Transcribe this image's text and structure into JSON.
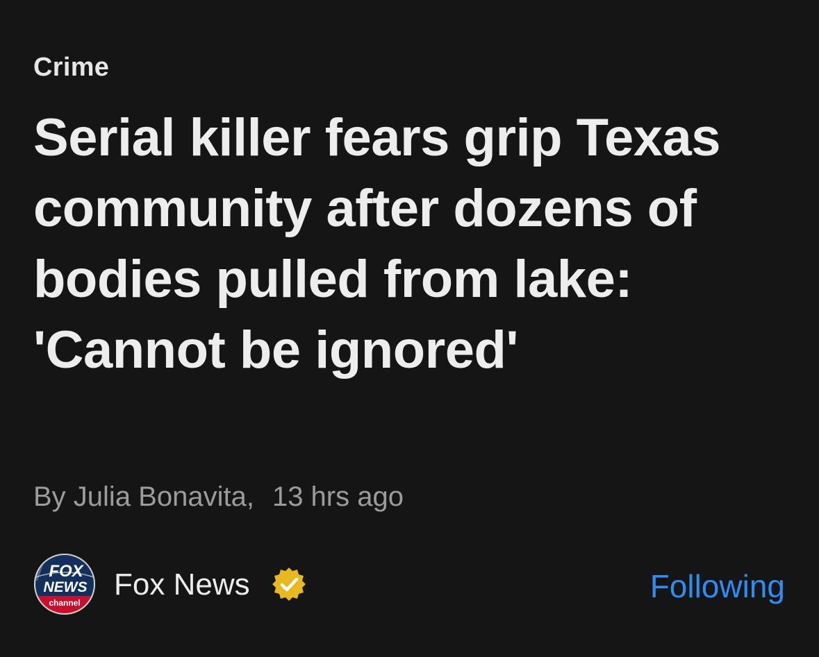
{
  "article": {
    "category": "Crime",
    "headline": "Serial killer fears grip Texas community after dozens of bodies pulled from lake: 'Cannot be ignored'",
    "author": "By Julia Bonavita,",
    "time": "13 hrs ago"
  },
  "source": {
    "name": "Fox News",
    "logo_text_top": "FOX",
    "logo_text_mid": "NEWS",
    "logo_text_bottom": "channel",
    "logo_icon": "fox-news-logo-icon",
    "verified_icon": "verified-badge-icon",
    "verified_color": "#e8b820",
    "follow_label": "Following",
    "follow_color": "#2f8cf3"
  }
}
